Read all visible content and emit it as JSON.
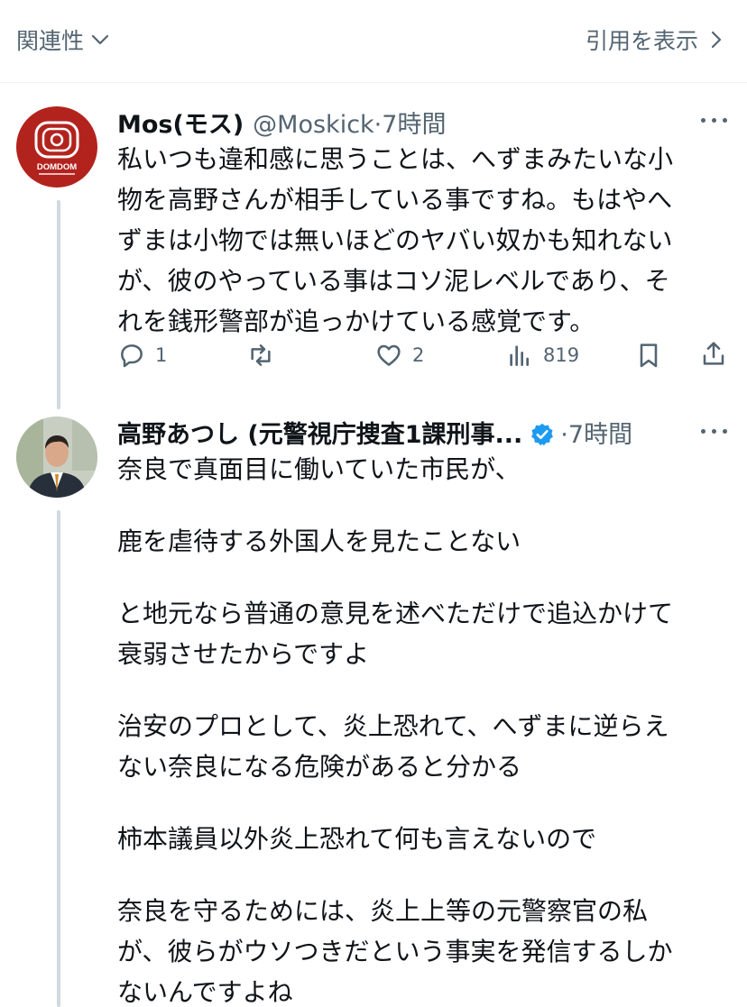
{
  "header": {
    "left_label": "関連性",
    "right_label": "引用を表示"
  },
  "tweets": [
    {
      "name": "Mos(モス)",
      "handle": "@Moskick",
      "separator": "·",
      "time": "7時間",
      "avatar_text": "DOMDOM",
      "lines": [
        "私いつも違和感に思うことは、へずまみたいな小",
        "物を高野さんが相手している事ですね。もはやへ",
        "ずまは小物では無いほどのヤバい奴かも知れない",
        "が、彼のやっている事はコソ泥レベルであり、そ",
        "れを銭形警部が追っかけている感覚です。"
      ],
      "actions": {
        "replies": "1",
        "reposts": "",
        "likes": "2",
        "views": "819"
      }
    },
    {
      "name": "高野あつし (元警視庁捜査1課刑事...",
      "separator": "·",
      "time": "7時間",
      "verified": true,
      "paragraphs": [
        [
          "奈良で真面目に働いていた市民が、"
        ],
        [
          "鹿を虐待する外国人を見たことない"
        ],
        [
          "と地元なら普通の意見を述べただけで追込かけて",
          "衰弱させたからですよ"
        ],
        [
          "治安のプロとして、炎上恐れて、へずまに逆らえ",
          "ない奈良になる危険があると分かる"
        ],
        [
          "柿本議員以外炎上恐れて何も言えないので"
        ],
        [
          "奈良を守るためには、炎上上等の元警察官の私",
          "が、彼らがウソつきだという事実を発信するしか",
          "ないんですよね"
        ]
      ]
    }
  ],
  "colors": {
    "text": "#0f1419",
    "secondary": "#536471",
    "verified": "#1d9bf0",
    "thread_line": "#cfd9de",
    "domdom_red": "#b3231e"
  }
}
